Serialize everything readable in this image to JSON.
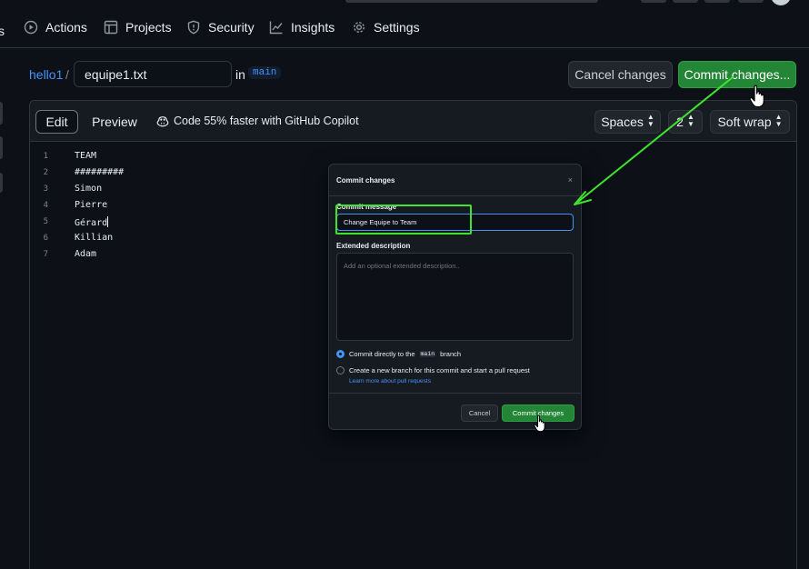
{
  "nav": {
    "tabs": [
      {
        "label": "Actions",
        "icon": "play-circle-icon"
      },
      {
        "label": "Projects",
        "icon": "table-icon"
      },
      {
        "label": "Security",
        "icon": "shield-icon"
      },
      {
        "label": "Insights",
        "icon": "graph-icon"
      },
      {
        "label": "Settings",
        "icon": "gear-icon"
      }
    ]
  },
  "header": {
    "repo": "hello1",
    "separator": "/",
    "filename": "equipe1.txt",
    "in_label": "in",
    "branch": "main",
    "cancel_label": "Cancel changes",
    "commit_label": "Commit changes..."
  },
  "editor": {
    "edit_tab": "Edit",
    "preview_tab": "Preview",
    "copilot_text": "Code 55% faster with GitHub Copilot",
    "indent_mode": "Spaces",
    "indent_size": "2",
    "wrap_mode": "Soft wrap",
    "lines": [
      {
        "n": "1",
        "text": "TEAM"
      },
      {
        "n": "2",
        "text": "#########"
      },
      {
        "n": "3",
        "text": "Simon"
      },
      {
        "n": "4",
        "text": "Pierre"
      },
      {
        "n": "5",
        "text": "Gérard"
      },
      {
        "n": "6",
        "text": "Killian"
      },
      {
        "n": "7",
        "text": "Adam"
      }
    ]
  },
  "modal": {
    "title": "Commit changes",
    "close": "×",
    "message_label": "Commit message",
    "message_value": "Change Equipe to Team",
    "description_label": "Extended description",
    "description_placeholder": "Add an optional extended description..",
    "option_direct_prefix": "Commit directly to the",
    "option_direct_branch": "main",
    "option_direct_suffix": "branch",
    "option_new_branch": "Create a new branch for this commit and start a pull request",
    "learn_more": "Learn more about pull requests",
    "cancel_label": "Cancel",
    "commit_label": "Commit changes"
  },
  "colors": {
    "accent_green": "#238636",
    "link_blue": "#4493f8",
    "annotation_green": "#3fe52d",
    "background": "#0d1117"
  }
}
